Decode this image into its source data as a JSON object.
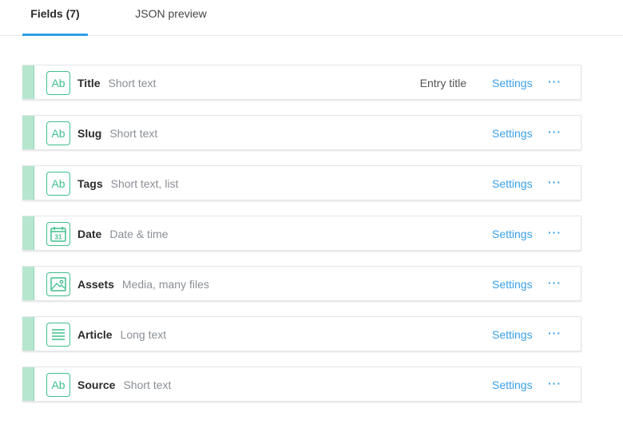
{
  "tabs": [
    {
      "label": "Fields (7)",
      "active": true
    },
    {
      "label": "JSON preview",
      "active": false
    }
  ],
  "fields": [
    {
      "name": "Title",
      "type": "Short text",
      "icon": "text-icon",
      "icon_label": "Ab",
      "entry_title": "Entry title",
      "settings_label": "Settings",
      "more_label": "···"
    },
    {
      "name": "Slug",
      "type": "Short text",
      "icon": "text-icon",
      "icon_label": "Ab",
      "entry_title": "",
      "settings_label": "Settings",
      "more_label": "···"
    },
    {
      "name": "Tags",
      "type": "Short text, list",
      "icon": "text-icon",
      "icon_label": "Ab",
      "entry_title": "",
      "settings_label": "Settings",
      "more_label": "···"
    },
    {
      "name": "Date",
      "type": "Date & time",
      "icon": "calendar-icon",
      "icon_label": "31",
      "entry_title": "",
      "settings_label": "Settings",
      "more_label": "···"
    },
    {
      "name": "Assets",
      "type": "Media, many files",
      "icon": "image-icon",
      "icon_label": "",
      "entry_title": "",
      "settings_label": "Settings",
      "more_label": "···"
    },
    {
      "name": "Article",
      "type": "Long text",
      "icon": "long-text-icon",
      "icon_label": "",
      "entry_title": "",
      "settings_label": "Settings",
      "more_label": "···"
    },
    {
      "name": "Source",
      "type": "Short text",
      "icon": "text-icon",
      "icon_label": "Ab",
      "entry_title": "",
      "settings_label": "Settings",
      "more_label": "···"
    }
  ],
  "colors": {
    "accent": "#2e9ee6",
    "link": "#3aa0e8",
    "field_icon": "#3fbf8c",
    "handle": "#b7e6cf"
  }
}
